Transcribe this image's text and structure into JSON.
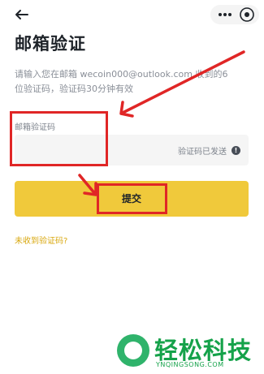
{
  "header": {
    "back_icon": "arrow-left-icon",
    "more_icon": "more-horizontal-icon",
    "close_icon": "close-circle-icon"
  },
  "page": {
    "title": "邮箱验证",
    "description": "请输入您在邮箱 wecoin000@outlook.com 收到的6\n位验证码，验证码30分钟有效"
  },
  "form": {
    "code_label": "邮箱验证码",
    "code_value": "",
    "status_text": "验证码已发送",
    "status_icon": "info-circle-icon",
    "submit_label": "提交",
    "resend_link": "未收到验证码?"
  },
  "watermark": {
    "brand": "轻松科技",
    "domain": "YNQINGSONG.COM"
  },
  "colors": {
    "accent": "#f0c93b",
    "link": "#d9a80f",
    "annotation": "#e02626",
    "watermark": "#15a24a"
  }
}
